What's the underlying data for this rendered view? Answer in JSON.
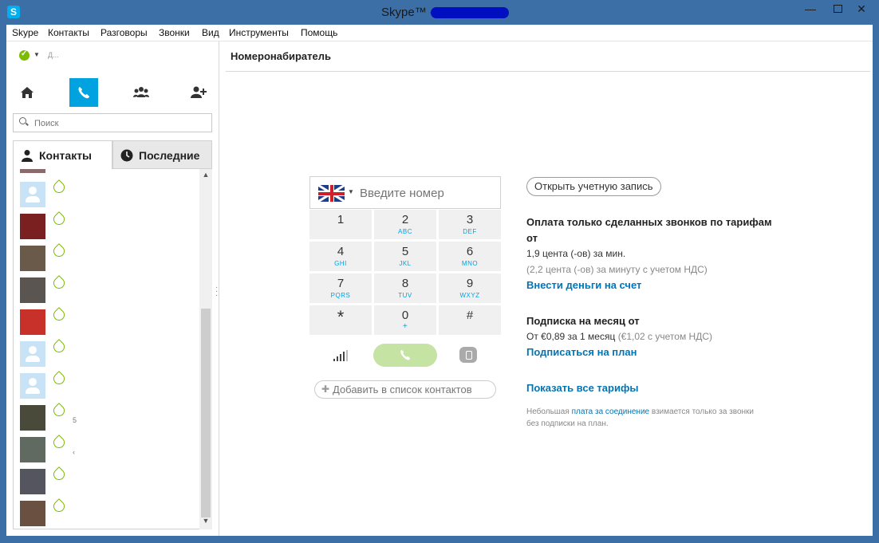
{
  "window": {
    "app_icon": "S",
    "title": "Skype™ -",
    "minimize": "—",
    "close": "✕"
  },
  "menu": [
    "Skype",
    "Контакты",
    "Разговоры",
    "Звонки",
    "Вид",
    "Инструменты",
    "Помощь"
  ],
  "sidebar": {
    "status_name": "Д...",
    "search": {
      "placeholder": "Поиск",
      "value": ""
    },
    "tabs": {
      "contacts": "Контакты",
      "recent": "Последние"
    },
    "nav_icons": [
      "home-icon",
      "phone-icon",
      "group-icon",
      "add-contact-icon"
    ],
    "contacts": [
      {
        "avatar": "default",
        "extra": ""
      },
      {
        "avatar": "photo",
        "color": "#7a2020",
        "extra": ""
      },
      {
        "avatar": "photo",
        "color": "#6a5a4a",
        "extra": ""
      },
      {
        "avatar": "photo",
        "color": "#5a5550",
        "extra": ""
      },
      {
        "avatar": "photo",
        "color": "#c8302a",
        "extra": ""
      },
      {
        "avatar": "default",
        "extra": ""
      },
      {
        "avatar": "default",
        "extra": ""
      },
      {
        "avatar": "photo",
        "color": "#4a4a3a",
        "extra": "5"
      },
      {
        "avatar": "photo",
        "color": "#606a60",
        "extra": "‹"
      },
      {
        "avatar": "photo",
        "color": "#555560",
        "extra": ""
      },
      {
        "avatar": "photo",
        "color": "#6a5040",
        "extra": ""
      }
    ]
  },
  "dialpad": {
    "page_title": "Номеронабиратель",
    "number_placeholder": "Введите номер",
    "country_flag": "uk-flag-icon",
    "keys": [
      {
        "num": "1",
        "letters": ""
      },
      {
        "num": "2",
        "letters": "ABC"
      },
      {
        "num": "3",
        "letters": "DEF"
      },
      {
        "num": "4",
        "letters": "GHI"
      },
      {
        "num": "5",
        "letters": "JKL"
      },
      {
        "num": "6",
        "letters": "MNO"
      },
      {
        "num": "7",
        "letters": "PQRS"
      },
      {
        "num": "8",
        "letters": "TUV"
      },
      {
        "num": "9",
        "letters": "WXYZ"
      },
      {
        "num": "*",
        "letters": ""
      },
      {
        "num": "0",
        "letters": "+"
      },
      {
        "num": "#",
        "letters": ""
      }
    ],
    "add_to_contacts": "Добавить в список контактов"
  },
  "rates": {
    "open_account": "Открыть учетную запись",
    "pay_heading_1": "Оплата только сделанных звонков по тарифам",
    "pay_heading_2": "от",
    "per_minute": "1,9 цента (-ов) за мин.",
    "per_minute_vat": "(2,2 цента (-ов) за минуту с учетом НДС)",
    "add_money": "Внести деньги на счет",
    "sub_heading": "Подписка на месяц от",
    "sub_price": "От €0,89 за 1 месяц",
    "sub_price_vat": "(€1,02 с учетом НДС)",
    "subscribe": "Подписаться на план",
    "show_all": "Показать все тарифы",
    "note_prefix": "Небольшая",
    "note_link": "плата за соединение",
    "note_suffix": "взимается только за звонки",
    "note_line2": "без подписки на план."
  },
  "colors": {
    "accent": "#00a3e0",
    "link": "#0076b6",
    "presence": "#7cbb00",
    "call_button": "#c5e3a3"
  }
}
